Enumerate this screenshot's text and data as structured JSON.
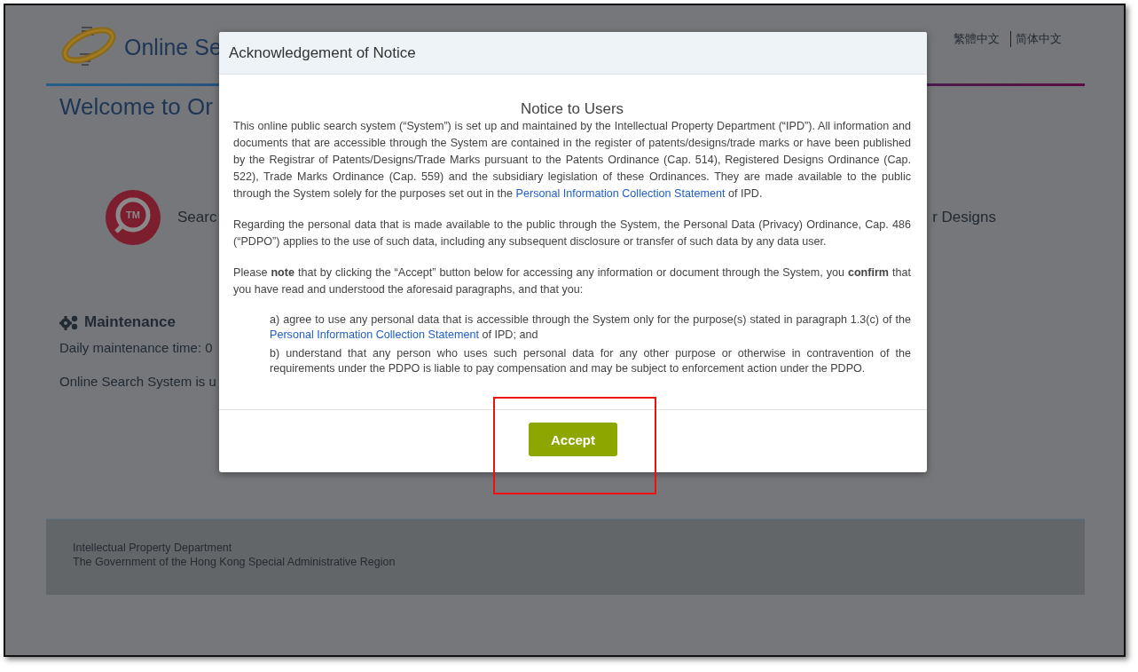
{
  "header": {
    "title": "Online Se",
    "languages": [
      "繁體中文",
      "简体中文"
    ]
  },
  "welcome": "Welcome to Or",
  "services": [
    "Searc",
    "r Designs"
  ],
  "service_icon_text": "TM",
  "maintenance": {
    "heading": "Maintenance",
    "lines": [
      "Daily maintenance time: 0",
      "Online Search System is u"
    ]
  },
  "footer": {
    "lines": [
      "Intellectual Property Department",
      "The Government of the Hong Kong Special Administrative Region"
    ]
  },
  "modal": {
    "title": "Acknowledgement of Notice",
    "heading": "Notice to Users",
    "paragraphs": [
      {
        "before": "This online public search system (“System”) is set up and maintained by the Intellectual Property Department (“IPD”). All information and documents that are accessible through the System are contained in the register of patents/designs/trade marks or have been published by the Registrar of Patents/Designs/Trade Marks pursuant to the Patents Ordinance (Cap. 514), Registered Designs Ordinance (Cap. 522), Trade Marks Ordinance (Cap. 559) and the subsidiary legislation of these Ordinances. They are made available to the public through the System solely for the purposes set out in the",
        "link": "Personal Information Collection Statement",
        "after": "of IPD."
      },
      {
        "before": "Regarding the personal data that is made available to the public through the System, the Personal Data (Privacy) Ordinance, Cap. 486 (“PDPO”) applies to the use of such data, including any subsequent disclosure or transfer of such data by any data user."
      },
      {
        "before": "Please **note** that by clicking the “Accept” button below for accessing any information or document through the System, you **confirm** that you have read and understood the aforesaid paragraphs, and that you:"
      }
    ],
    "items": [
      {
        "before": "a) agree to use any personal data that is accessible through the System only for the purpose(s) stated in paragraph 1.3(c) of the",
        "link": "Personal Information Collection Statement",
        "after": "of IPD; and"
      },
      {
        "before": "b) understand that any person who uses such personal data for any other purpose or otherwise in contravention of the requirements under the PDPO is liable to pay compensation and may be subject to enforcement action under the PDPO."
      }
    ],
    "button": "Accept"
  }
}
